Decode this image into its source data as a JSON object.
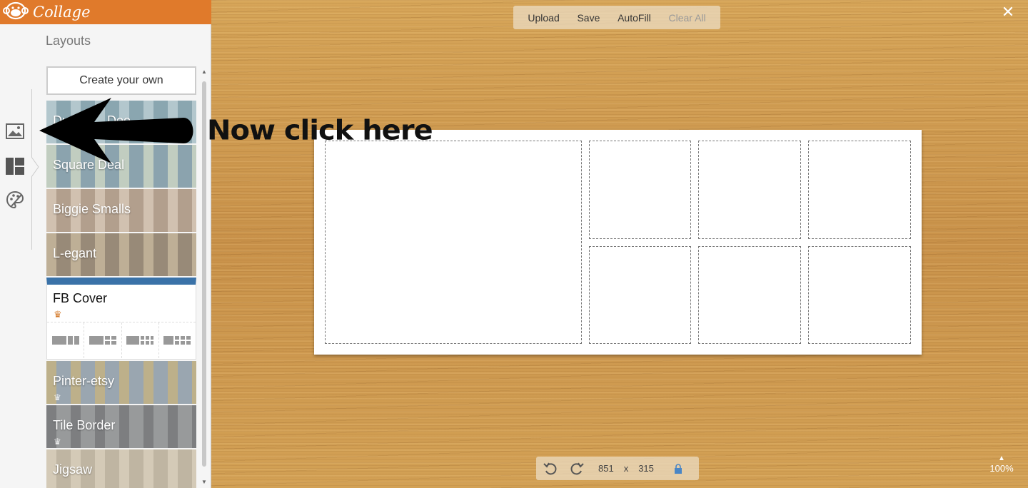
{
  "app": {
    "brand": "Collage"
  },
  "toolbar": {
    "upload": "Upload",
    "save": "Save",
    "autofill": "AutoFill",
    "clear_all": "Clear All"
  },
  "panel": {
    "title": "Layouts",
    "create_button": "Create your own",
    "layouts": [
      {
        "label": "Duplex... Doo",
        "bg": "#7a9aa6",
        "accent": "#a9c0c6"
      },
      {
        "label": "Square Deal",
        "bg": "#7c97a3",
        "accent": "#b9c6b8"
      },
      {
        "label": "Biggie Smalls",
        "bg": "#a8927e",
        "accent": "#cbb9a5"
      },
      {
        "label": "L-egant",
        "bg": "#8a7a66",
        "accent": "#b5a488"
      }
    ],
    "fb_cover": {
      "label": "FB Cover"
    },
    "layouts_after": [
      {
        "label": "Pinter-etsy",
        "bg": "#8d9aa6",
        "accent": "#b4a67a"
      },
      {
        "label": "Tile Border",
        "bg": "#8a8c8e",
        "accent": "#6b6d6f"
      },
      {
        "label": "Jigsaw",
        "bg": "#b7ab96",
        "accent": "#cfc3ad"
      }
    ]
  },
  "canvas": {
    "width": "851",
    "x_label": "x",
    "height": "315",
    "zoom": "100%"
  },
  "annotation": {
    "text": "Now click here"
  }
}
